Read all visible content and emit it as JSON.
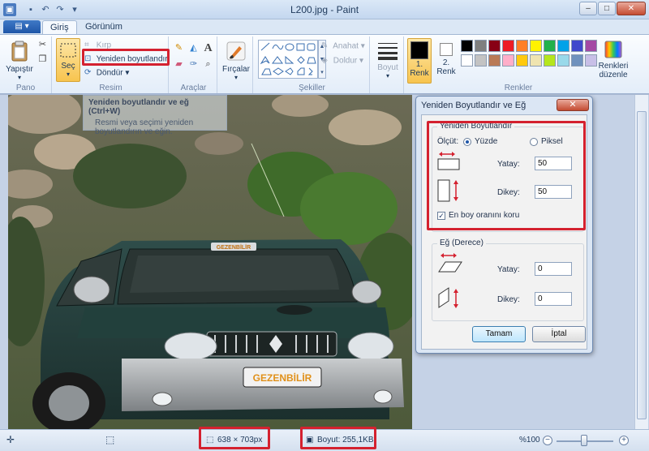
{
  "window": {
    "title": "L200.jpg - Paint"
  },
  "tabs": [
    {
      "label": "Giriş"
    },
    {
      "label": "Görünüm"
    }
  ],
  "ribbon": {
    "pano": {
      "label": "Pano",
      "paste": "Yapıştır"
    },
    "resim": {
      "label": "Resim",
      "select": "Seç",
      "crop": "Kırp",
      "resize": "Yeniden boyutlandır",
      "rotate": "Döndür"
    },
    "araclar": {
      "label": "Araçlar"
    },
    "brushes": "Fırçalar",
    "sekiller": {
      "label": "Şekiller",
      "outline": "Anahat",
      "fill": "Doldur"
    },
    "size": "Boyut",
    "colors": {
      "label": "Renkler",
      "color1": "1.\nRenk",
      "color1_line1": "1.",
      "color1_line2": "Renk",
      "color2_line1": "2.",
      "color2_line2": "Renk",
      "edit_line1": "Renkleri",
      "edit_line2": "düzenle",
      "palette_row1": [
        "#000000",
        "#7f7f7f",
        "#880015",
        "#ed1c24",
        "#ff7f27",
        "#fff200",
        "#22b14c",
        "#00a2e8",
        "#3f48cc",
        "#a349a4"
      ],
      "palette_row2": [
        "#ffffff",
        "#c3c3c3",
        "#b97a57",
        "#ffaec9",
        "#ffc90e",
        "#efe4b0",
        "#b5e61d",
        "#99d9ea",
        "#7092be",
        "#c8bfe7"
      ]
    }
  },
  "tooltip": {
    "title": "Yeniden boyutlandır ve eğ (Ctrl+W)",
    "desc_line1": "Resmi veya seçimi yeniden",
    "desc_line2": "boyutlandırın ve eğin."
  },
  "dialog": {
    "title": "Yeniden Boyutlandır ve Eğ",
    "resize_section": "Yeniden Boyutlandır",
    "by_label": "Ölçüt:",
    "percent": "Yüzde",
    "pixels": "Piksel",
    "horizontal": "Yatay:",
    "vertical": "Dikey:",
    "h_value": "50",
    "v_value": "50",
    "aspect": "En boy oranını koru",
    "aspect_checked": true,
    "skew_section": "Eğ (Derece)",
    "skew_h_value": "0",
    "skew_v_value": "0",
    "ok": "Tamam",
    "cancel": "İptal"
  },
  "statusbar": {
    "dimensions": "638 × 703px",
    "filesize": "Boyut: 255,1KB",
    "zoom": "%100"
  },
  "photo": {
    "plate_text": "GEZENBİLİR",
    "windshield_text": "GEZENBİLİR"
  }
}
